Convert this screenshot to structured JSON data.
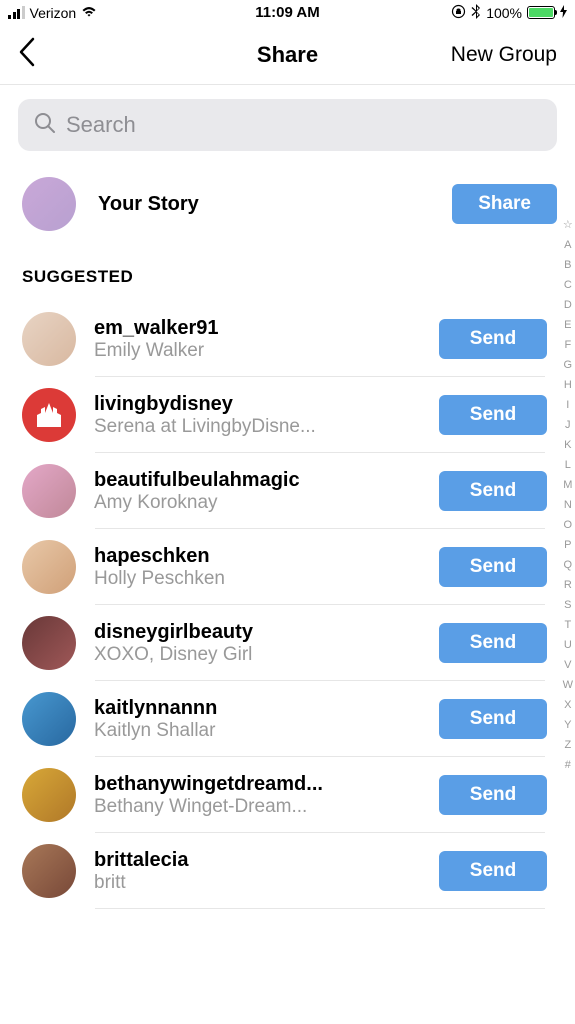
{
  "statusBar": {
    "carrier": "Verizon",
    "time": "11:09 AM",
    "battery": "100%"
  },
  "header": {
    "title": "Share",
    "newGroup": "New Group"
  },
  "search": {
    "placeholder": "Search"
  },
  "yourStory": {
    "label": "Your Story",
    "buttonLabel": "Share"
  },
  "suggested": {
    "header": "SUGGESTED",
    "sendLabel": "Send",
    "contacts": [
      {
        "username": "em_walker91",
        "fullname": "Emily Walker"
      },
      {
        "username": "livingbydisney",
        "fullname": "Serena at LivingbyDisne..."
      },
      {
        "username": "beautifulbeulahmagic",
        "fullname": "Amy Koroknay"
      },
      {
        "username": "hapeschken",
        "fullname": "Holly Peschken"
      },
      {
        "username": "disneygirlbeauty",
        "fullname": "XOXO, Disney Girl"
      },
      {
        "username": "kaitlynnannn",
        "fullname": "Kaitlyn Shallar"
      },
      {
        "username": "bethanywingetdreamd...",
        "fullname": "Bethany Winget-Dream..."
      },
      {
        "username": "brittalecia",
        "fullname": "britt"
      }
    ]
  },
  "alphaIndex": [
    "☆",
    "A",
    "B",
    "C",
    "D",
    "E",
    "F",
    "G",
    "H",
    "I",
    "J",
    "K",
    "L",
    "M",
    "N",
    "O",
    "P",
    "Q",
    "R",
    "S",
    "T",
    "U",
    "V",
    "W",
    "X",
    "Y",
    "Z",
    "#"
  ]
}
